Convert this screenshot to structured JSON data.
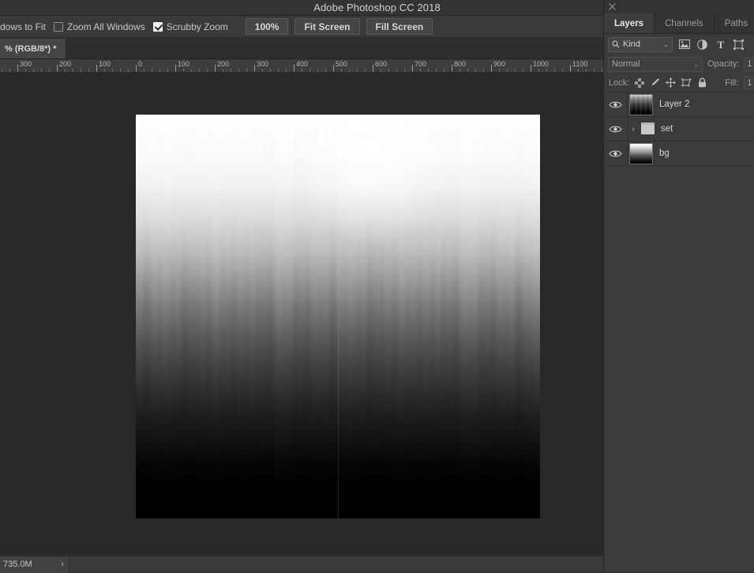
{
  "app": {
    "title": "Adobe Photoshop CC 2018"
  },
  "options_bar": {
    "resize_windows_label": "dows to Fit",
    "zoom_all_windows_label": "Zoom All Windows",
    "zoom_all_windows_checked": false,
    "scrubby_zoom_label": "Scrubby Zoom",
    "scrubby_zoom_checked": true,
    "zoom_100_label": "100%",
    "fit_screen_label": "Fit Screen",
    "fill_screen_label": "Fill Screen"
  },
  "document": {
    "tab_label": "% (RGB/8*) *"
  },
  "ruler": {
    "labels": [
      "300",
      "200",
      "100",
      "0",
      "100",
      "200",
      "300",
      "400",
      "500",
      "600",
      "700",
      "800",
      "900",
      "1000",
      "1100"
    ]
  },
  "status_bar": {
    "doc_size": "735.0M",
    "expand_icon": "›"
  },
  "panel": {
    "close_icon": "close-icon",
    "tabs": [
      {
        "label": "Layers",
        "active": true
      },
      {
        "label": "Channels",
        "active": false
      },
      {
        "label": "Paths",
        "active": false
      }
    ],
    "filter": {
      "search_icon": "⌕",
      "kind_label": "Kind",
      "chevron": "⌄",
      "icons": [
        "image-filter-icon",
        "adjustment-filter-icon",
        "type-filter-icon",
        "shape-filter-icon"
      ],
      "type_glyph": "T"
    },
    "blend": {
      "mode": "Normal",
      "chevron": "⌄",
      "opacity_label": "Opacity:",
      "opacity_value": "1"
    },
    "lock": {
      "label": "Lock:",
      "icons": [
        "lock-transparency-icon",
        "lock-image-pixels-icon",
        "lock-position-icon",
        "lock-artboard-icon",
        "lock-all-icon"
      ],
      "fill_label": "Fill:",
      "fill_value": "1"
    },
    "layers": [
      {
        "name": "Layer 2",
        "visible": true,
        "type": "raster",
        "thumb": "grad-layer2"
      },
      {
        "name": "set",
        "visible": true,
        "type": "group",
        "thumb": "folder",
        "expand_chevron": "›"
      },
      {
        "name": "bg",
        "visible": true,
        "type": "raster",
        "thumb": "grad-bg"
      }
    ],
    "eye_glyph": "◉"
  },
  "colors": {
    "app_background": "#323232",
    "panel_background": "#3b3b3b",
    "canvas_background": "#282828",
    "title_bar": "#333333",
    "options_bar": "#393939",
    "text_primary": "#d6d6d6",
    "text_secondary": "#9c9c9c"
  },
  "canvas": {
    "description": "vertical light-streak gradient, white at top fading to black at bottom"
  }
}
